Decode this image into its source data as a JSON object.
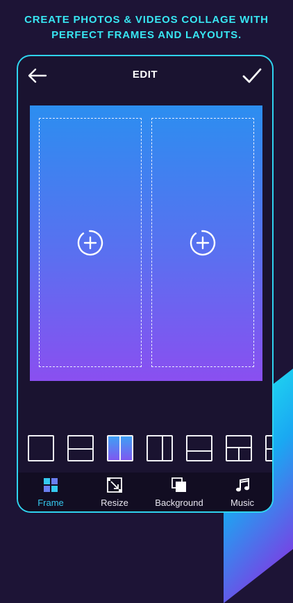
{
  "headline": {
    "line1": "CREATE PHOTOS &  VIDEOS COLLAGE WITH",
    "line2": "PERFECT FRAMES AND LAYOUTS."
  },
  "topbar": {
    "title": "EDIT",
    "back_icon": "arrow-left-icon",
    "done_icon": "checkmark-icon"
  },
  "canvas": {
    "slots": [
      {
        "icon": "add-circle-icon"
      },
      {
        "icon": "add-circle-icon"
      }
    ]
  },
  "layouts": {
    "selected_index": 2,
    "items": [
      "single",
      "two-rows",
      "two-columns",
      "split-column",
      "split-row",
      "grid-mixed",
      "more"
    ]
  },
  "bottom_nav": {
    "items": [
      {
        "label": "Frame",
        "icon": "frame-icon",
        "active": true
      },
      {
        "label": "Resize",
        "icon": "resize-icon",
        "active": false
      },
      {
        "label": "Background",
        "icon": "background-icon",
        "active": false
      },
      {
        "label": "Music",
        "icon": "music-note-icon",
        "active": false
      }
    ]
  },
  "colors": {
    "accent": "#2fd4ef",
    "headline": "#38e6f2",
    "active_nav": "#35c9ef",
    "canvas_top": "#2c8ef0",
    "canvas_bottom": "#8a4ff0"
  }
}
